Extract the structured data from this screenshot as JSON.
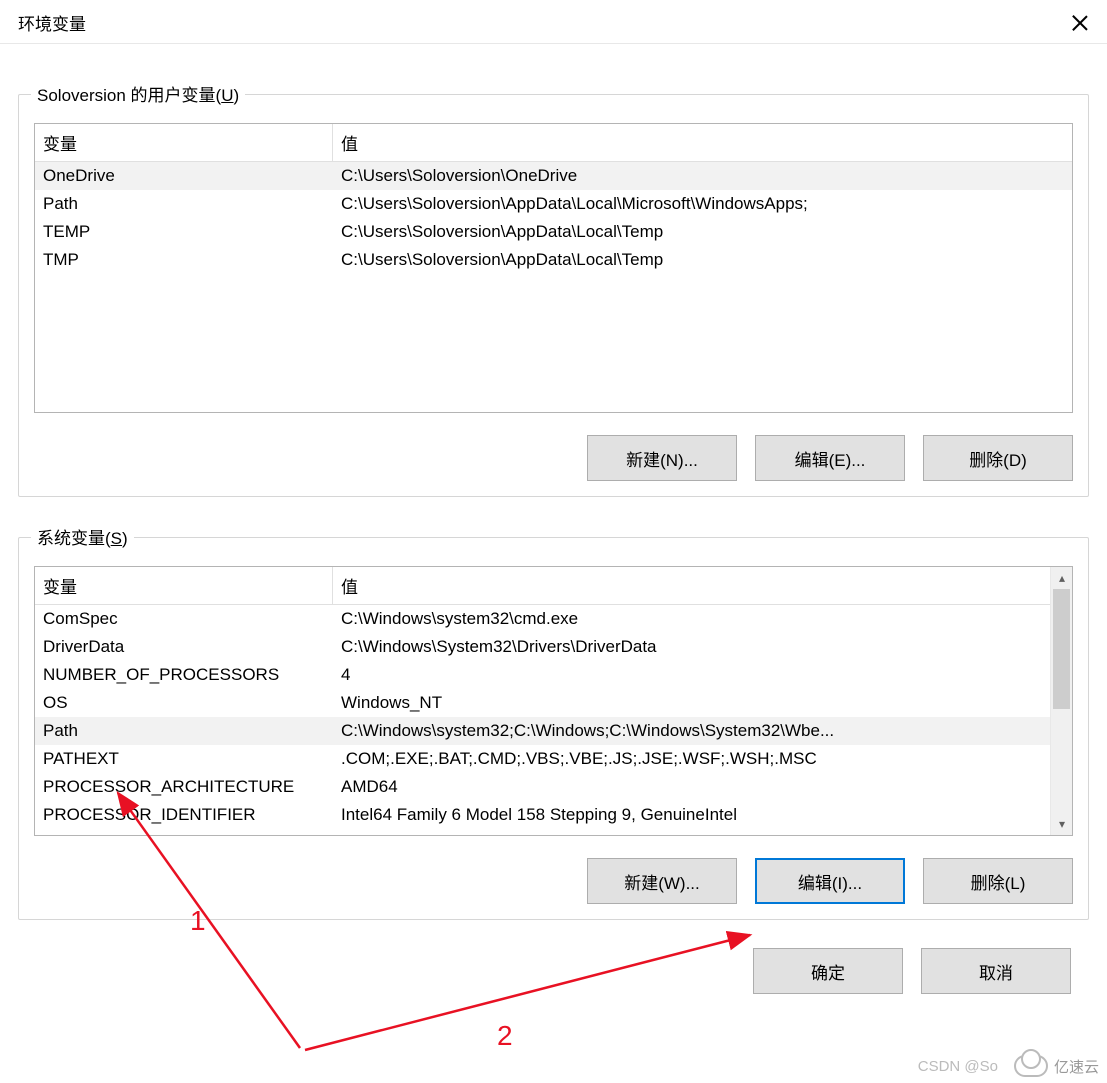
{
  "dialog": {
    "title": "环境变量"
  },
  "userGroup": {
    "legend_prefix": "Soloversion 的用户变量(",
    "legend_key": "U",
    "legend_suffix": ")",
    "headers": {
      "name": "变量",
      "value": "值"
    },
    "rows": [
      {
        "name": "OneDrive",
        "value": "C:\\Users\\Soloversion\\OneDrive",
        "selected": true
      },
      {
        "name": "Path",
        "value": "C:\\Users\\Soloversion\\AppData\\Local\\Microsoft\\WindowsApps;"
      },
      {
        "name": "TEMP",
        "value": "C:\\Users\\Soloversion\\AppData\\Local\\Temp"
      },
      {
        "name": "TMP",
        "value": "C:\\Users\\Soloversion\\AppData\\Local\\Temp"
      }
    ],
    "buttons": {
      "new": "新建(N)...",
      "edit": "编辑(E)...",
      "delete": "删除(D)"
    }
  },
  "sysGroup": {
    "legend_prefix": "系统变量(",
    "legend_key": "S",
    "legend_suffix": ")",
    "headers": {
      "name": "变量",
      "value": "值"
    },
    "rows": [
      {
        "name": "ComSpec",
        "value": "C:\\Windows\\system32\\cmd.exe"
      },
      {
        "name": "DriverData",
        "value": "C:\\Windows\\System32\\Drivers\\DriverData"
      },
      {
        "name": "NUMBER_OF_PROCESSORS",
        "value": "4"
      },
      {
        "name": "OS",
        "value": "Windows_NT"
      },
      {
        "name": "Path",
        "value": "C:\\Windows\\system32;C:\\Windows;C:\\Windows\\System32\\Wbe...",
        "selected": true
      },
      {
        "name": "PATHEXT",
        "value": ".COM;.EXE;.BAT;.CMD;.VBS;.VBE;.JS;.JSE;.WSF;.WSH;.MSC"
      },
      {
        "name": "PROCESSOR_ARCHITECTURE",
        "value": "AMD64"
      },
      {
        "name": "PROCESSOR_IDENTIFIER",
        "value": "Intel64 Family 6 Model 158 Stepping 9, GenuineIntel"
      }
    ],
    "buttons": {
      "new": "新建(W)...",
      "edit": "编辑(I)...",
      "delete": "删除(L)"
    }
  },
  "dialogButtons": {
    "ok": "确定",
    "cancel": "取消"
  },
  "annotations": {
    "label1": "1",
    "label2": "2"
  },
  "watermark": {
    "csdn": "CSDN @So",
    "brand": "亿速云"
  }
}
